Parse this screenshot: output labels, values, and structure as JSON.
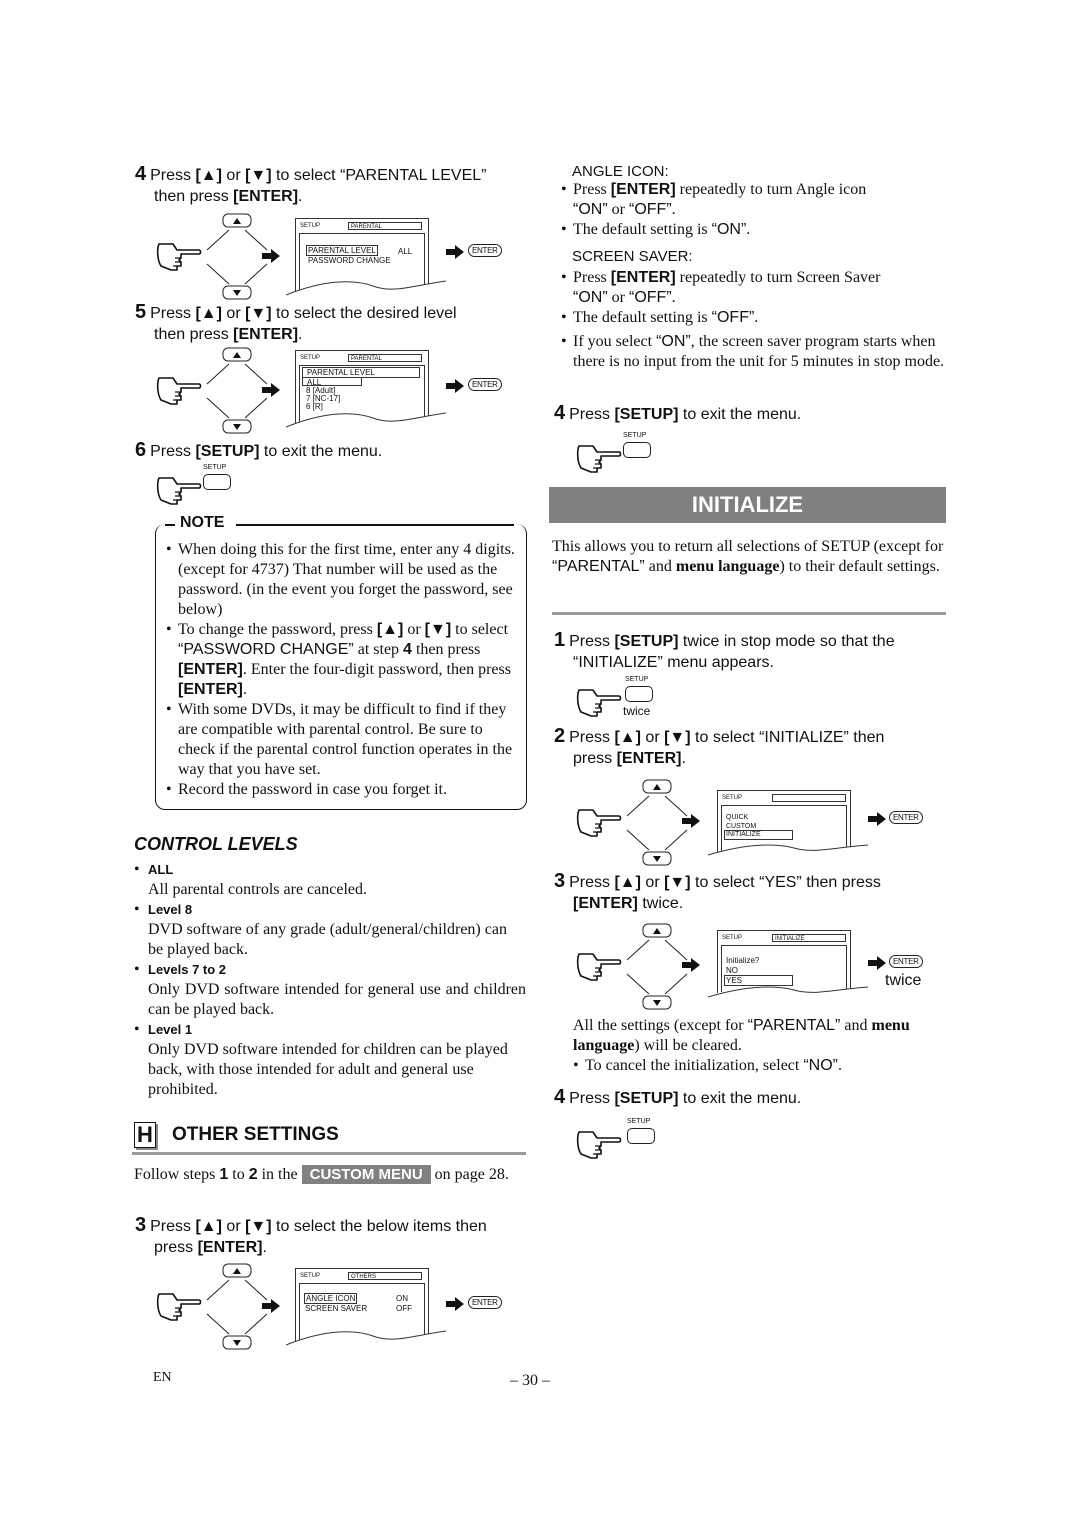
{
  "left": {
    "step4": {
      "num": "4",
      "line1_pre": "Press ",
      "up": "[▲]",
      "or": " or ",
      "down": "[▼]",
      "line1_post": " to select “PARENTAL LEVEL”",
      "line2_pre": "then press ",
      "enter": "[ENTER]",
      "line2_post": ".",
      "screen": {
        "header": "SETUP",
        "tab": "PARENTAL",
        "rows": [
          {
            "label": "PARENTAL LEVEL",
            "value": "ALL",
            "selected": true
          },
          {
            "label": "PASSWORD CHANGE",
            "value": "",
            "selected": false
          }
        ]
      },
      "enter_button": "ENTER"
    },
    "step5": {
      "num": "5",
      "line1_pre": "Press ",
      "up": "[▲]",
      "or": " or ",
      "down": "[▼]",
      "line1_post": " to select the desired level",
      "line2_pre": "then press ",
      "enter": "[ENTER]",
      "line2_post": ".",
      "screen": {
        "header": "SETUP",
        "tab": "PARENTAL",
        "title": "PARENTAL LEVEL",
        "rows": [
          "ALL",
          "8 [Adult]",
          "7 [NC-17]",
          "6 [R]"
        ]
      },
      "enter_button": "ENTER"
    },
    "step6": {
      "num": "6",
      "pre": "Press ",
      "key": "[SETUP]",
      "post": " to exit the menu.",
      "setup_label": "SETUP"
    },
    "note": {
      "title": "NOTE",
      "b1": "When doing this for the first time, enter any 4 digits. (except for 4737) That number will be used as the password. (in the event you forget the password, see below)",
      "b2_pre": "To change the password, press ",
      "b2_up": "[▲]",
      "b2_or": " or ",
      "b2_down": "[▼]",
      "b2_mid": " to select ",
      "b2_q": "“PASSWORD CHANGE”",
      "b2_at": " at step ",
      "b2_step": "4",
      "b2_then": " then press ",
      "b2_enter": "[ENTER]",
      "b2_mid2": ". Enter the four-digit password, then press ",
      "b2_enter2": "[ENTER]",
      "b2_end": ".",
      "b3": "With some DVDs, it may be difficult to find if they are compatible with parental control. Be sure to check if the parental control function operates in the way that you have set.",
      "b4": "Record the password in case you forget it."
    },
    "control_levels": {
      "title": "CONTROL LEVELS",
      "items": [
        {
          "label": "ALL",
          "desc": "All parental controls are canceled."
        },
        {
          "label": "Level 8",
          "desc": "DVD software of any grade (adult/general/children) can be played back."
        },
        {
          "label": "Levels 7 to 2",
          "desc": "Only DVD software intended for general use and children can be played back."
        },
        {
          "label": "Level 1",
          "desc": "Only DVD software intended for children can be played back, with those intended for adult and general use prohibited."
        }
      ]
    },
    "other_settings": {
      "letter": "H",
      "title": "OTHER SETTINGS",
      "follow_pre": "Follow steps ",
      "follow_s1": "1",
      "follow_to": " to ",
      "follow_s2": "2",
      "follow_in": " in the ",
      "badge": "CUSTOM MENU",
      "follow_post": " on page 28.",
      "step3": {
        "num": "3",
        "line1_pre": "Press ",
        "up": "[▲]",
        "or": " or ",
        "down": "[▼]",
        "line1_post": " to select the below items then",
        "line2_pre": "press ",
        "enter": "[ENTER]",
        "line2_post": ".",
        "screen": {
          "header": "SETUP",
          "tab": "OTHERS",
          "rows": [
            {
              "label": "ANGLE ICON",
              "value": "ON",
              "selected": true
            },
            {
              "label": "SCREEN SAVER",
              "value": "OFF",
              "selected": false
            }
          ]
        },
        "enter_button": "ENTER"
      }
    }
  },
  "right": {
    "angle_icon": {
      "title": "ANGLE ICON:",
      "b1_pre": "Press ",
      "b1_key": "[ENTER]",
      "b1_post": " repeatedly to turn Angle icon",
      "b1_l2a": "“ON”",
      "b1_l2or": " or ",
      "b1_l2b": "“OFF”",
      "b1_l2end": ".",
      "b2_pre": "The default setting is ",
      "b2_val": "“ON”",
      "b2_end": "."
    },
    "screen_saver": {
      "title": "SCREEN SAVER:",
      "b1_pre": "Press ",
      "b1_key": "[ENTER]",
      "b1_post": " repeatedly to turn Screen Saver",
      "b1_l2a": "“ON”",
      "b1_l2or": " or ",
      "b1_l2b": "“OFF”",
      "b1_l2end": ".",
      "b2_pre": "The default setting is ",
      "b2_val": "“OFF”",
      "b2_end": ".",
      "b3_pre": "If you select ",
      "b3_val": "“ON”",
      "b3_post": ", the screen saver program starts when there is no input from the unit for 5 minutes in stop mode."
    },
    "step4_exit": {
      "num": "4",
      "pre": "Press ",
      "key": "[SETUP]",
      "post": " to exit the menu.",
      "setup_label": "SETUP"
    },
    "initialize": {
      "title": "INITIALIZE",
      "intro_pre": "This allows you to return all selections of SETUP (except for ",
      "intro_q": "“PARENTAL”",
      "intro_and": " and ",
      "intro_bold": "menu language",
      "intro_post": ") to their default settings.",
      "step1": {
        "num": "1",
        "pre": "Press ",
        "key": "[SETUP]",
        "post": " twice in stop mode so that the",
        "line2": "“INITIALIZE” menu appears.",
        "setup_label": "SETUP",
        "twice": "twice"
      },
      "step2": {
        "num": "2",
        "line1_pre": "Press ",
        "up": "[▲]",
        "or": " or ",
        "down": "[▼]",
        "line1_post": " to select “INITIALIZE” then",
        "line2_pre": "press ",
        "enter": "[ENTER]",
        "line2_post": ".",
        "screen": {
          "header": "SETUP",
          "tab": "",
          "rows": [
            "QUICK",
            "CUSTOM",
            "INITIALIZE"
          ]
        },
        "enter_button": "ENTER"
      },
      "step3": {
        "num": "3",
        "line1_pre": "Press ",
        "up": "[▲]",
        "or": " or ",
        "down": "[▼]",
        "line1_post": " to select “YES” then press",
        "line2_key": "[ENTER]",
        "line2_post": " twice.",
        "screen": {
          "header": "SETUP",
          "tab": "INITIALIZE",
          "rows": [
            "Initialize?",
            "NO",
            "YES"
          ]
        },
        "enter_button": "ENTER",
        "twice": "twice"
      },
      "after_pre": "All the settings (except for ",
      "after_q": "“PARENTAL”",
      "after_and": " and ",
      "after_bold": "menu language",
      "after_post": ") will be cleared.",
      "cancel_pre": "To cancel the initialization, select ",
      "cancel_val": "“NO”",
      "cancel_end": ".",
      "step4": {
        "num": "4",
        "pre": "Press ",
        "key": "[SETUP]",
        "post": " to exit the menu.",
        "setup_label": "SETUP"
      }
    }
  },
  "footer": {
    "lang": "EN",
    "page": "– 30 –"
  }
}
